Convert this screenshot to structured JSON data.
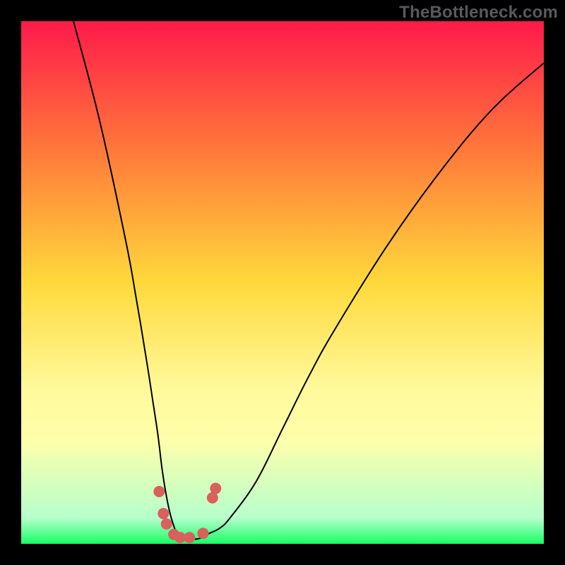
{
  "watermark": "TheBottleneck.com",
  "chart_data": {
    "type": "line",
    "title": "",
    "xlabel": "",
    "ylabel": "",
    "xlim": [
      0,
      100
    ],
    "ylim": [
      0,
      100
    ],
    "gradient_stops": [
      {
        "offset": 0,
        "color": "#ff1a4b"
      },
      {
        "offset": 0.25,
        "color": "#ff7a3a"
      },
      {
        "offset": 0.5,
        "color": "#ffd93b"
      },
      {
        "offset": 0.7,
        "color": "#fff99a"
      },
      {
        "offset": 0.8,
        "color": "#ffffaa"
      },
      {
        "offset": 0.95,
        "color": "#b6ffcc"
      },
      {
        "offset": 1.0,
        "color": "#1aff66"
      }
    ],
    "series": [
      {
        "name": "curve",
        "x": [
          10,
          15,
          20,
          22,
          24,
          26,
          27,
          28,
          29,
          30,
          32,
          34,
          36,
          38,
          40,
          45,
          50,
          55,
          60,
          70,
          80,
          90,
          100
        ],
        "y": [
          100,
          81,
          58,
          47,
          35,
          22,
          14,
          8,
          4,
          2,
          1,
          1,
          2,
          3,
          5,
          12,
          22,
          32,
          41,
          57,
          71,
          83,
          92
        ]
      }
    ],
    "markers": {
      "color": "#d9605b",
      "radius_px": 8,
      "points": [
        {
          "x": 26.4,
          "y": 10.0
        },
        {
          "x": 27.2,
          "y": 5.8
        },
        {
          "x": 27.8,
          "y": 3.8
        },
        {
          "x": 29.2,
          "y": 1.8
        },
        {
          "x": 30.4,
          "y": 1.2
        },
        {
          "x": 32.2,
          "y": 1.2
        },
        {
          "x": 34.8,
          "y": 2.0
        },
        {
          "x": 36.6,
          "y": 8.8
        },
        {
          "x": 37.2,
          "y": 10.6
        }
      ]
    }
  }
}
